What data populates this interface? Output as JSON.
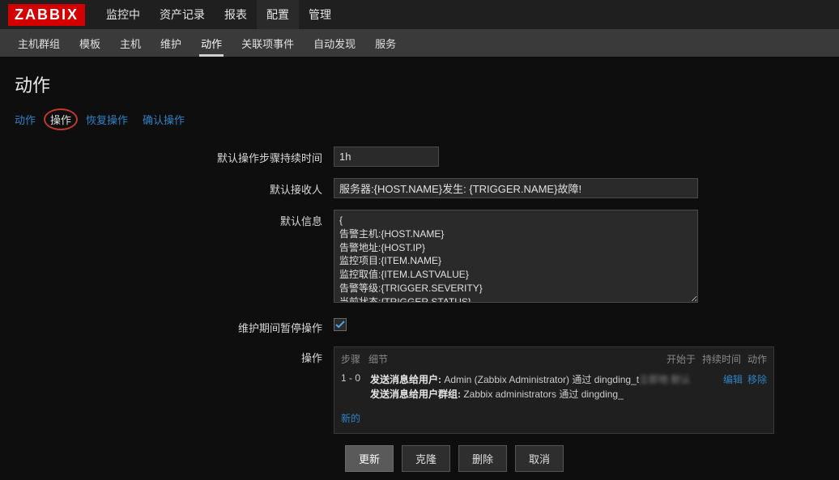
{
  "logo": "ZABBIX",
  "topnav": [
    "监控中",
    "资产记录",
    "报表",
    "配置",
    "管理"
  ],
  "topnav_active": 3,
  "subnav": [
    "主机群组",
    "模板",
    "主机",
    "维护",
    "动作",
    "关联项事件",
    "自动发现",
    "服务"
  ],
  "subnav_active": 4,
  "page_title": "动作",
  "tabs": [
    "动作",
    "操作",
    "恢复操作",
    "确认操作"
  ],
  "tabs_active": 1,
  "form": {
    "default_step_duration_label": "默认操作步骤持续时间",
    "default_step_duration_value": "1h",
    "default_subject_label": "默认接收人",
    "default_subject_value": "服务器:{HOST.NAME}发生: {TRIGGER.NAME}故障!",
    "default_message_label": "默认信息",
    "default_message_value": "{\n告警主机:{HOST.NAME}\n告警地址:{HOST.IP}\n监控项目:{ITEM.NAME}\n监控取值:{ITEM.LASTVALUE}\n告警等级:{TRIGGER.SEVERITY}\n当前状态:{TRIGGER.STATUS}",
    "pause_label": "维护期间暂停操作",
    "pause_checked": true,
    "operations_label": "操作"
  },
  "ops": {
    "header_steps": "步骤",
    "header_detail": "细节",
    "header_start": "开始于",
    "header_duration": "持续时间",
    "header_action": "动作",
    "rows": [
      {
        "steps": "1 - 0",
        "line1_bold": "发送消息给用户:",
        "line1_rest": " Admin (Zabbix Administrator) 通过 dingding_t",
        "line1_blur": "立即地 默认",
        "line2_bold": "发送消息给用户群组:",
        "line2_rest": " Zabbix administrators 通过 dingding_",
        "edit": "编辑",
        "remove": "移除"
      }
    ],
    "new_link": "新的"
  },
  "buttons": {
    "update": "更新",
    "clone": "克隆",
    "delete": "删除",
    "cancel": "取消"
  }
}
